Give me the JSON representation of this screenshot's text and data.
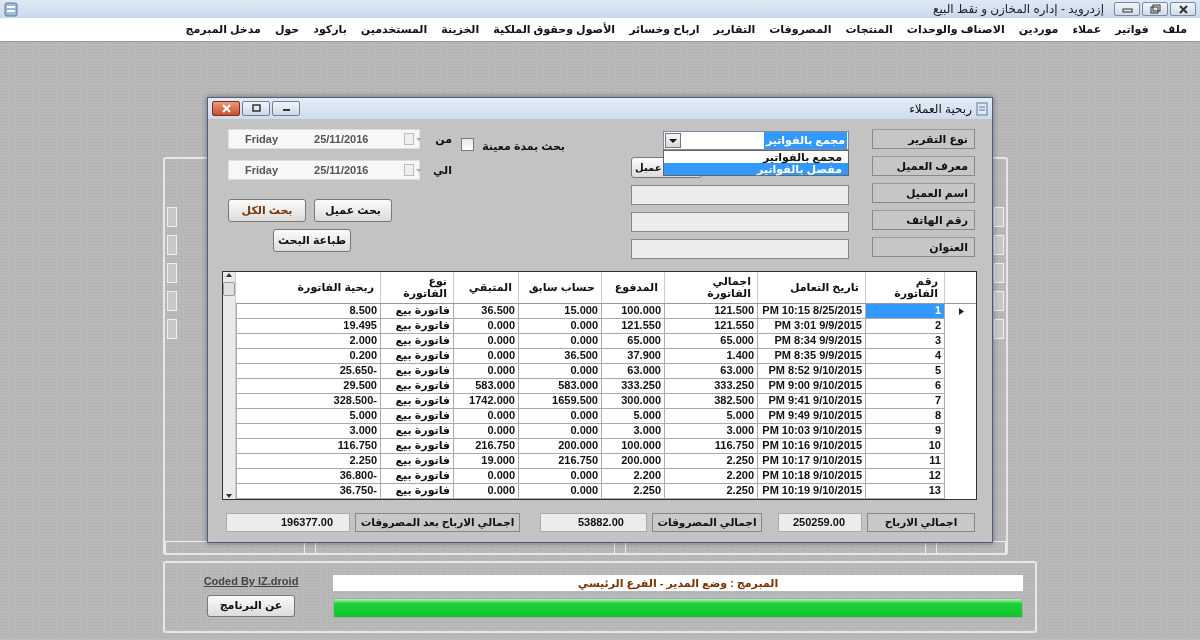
{
  "window": {
    "title": "إزدرويد - إداره المخازن و نقط البيع"
  },
  "menu": [
    "ملف",
    "فواتير",
    "عملاء",
    "موردين",
    "الاصناف والوحدات",
    "المنتجات",
    "المصروفات",
    "التقارير",
    "ارباح وخسائر",
    "الأصول وحقوق الملكية",
    "الخزينة",
    "المستخدمين",
    "باركود",
    "حول",
    "مدخل المبرمج"
  ],
  "dialog": {
    "title": "ربحية العملاء",
    "form_fields": [
      {
        "label": "نوع التقرير",
        "kind": "combo",
        "value": "مجمع بالفواتير"
      },
      {
        "label": "معرف العميل",
        "kind": "button",
        "button": "عميل"
      },
      {
        "label": "اسم العميل",
        "kind": "input"
      },
      {
        "label": "رقم الهاتف",
        "kind": "input"
      },
      {
        "label": "العنوان",
        "kind": "input"
      }
    ],
    "dropdown": [
      {
        "label": "مجمع بالفواتير",
        "selected": false
      },
      {
        "label": "مفصل بالفواتير",
        "selected": true
      }
    ],
    "period_check": {
      "label": "بحث بمدة معينة",
      "checked": false
    },
    "dates": [
      {
        "label": "من",
        "day": "Friday",
        "date": "25/11/2016"
      },
      {
        "label": "الي",
        "day": "Friday",
        "date": "25/11/2016"
      }
    ],
    "buttons": [
      {
        "label": "بحث الكل",
        "focused": true
      },
      {
        "label": "بحث عميل",
        "focused": false
      },
      {
        "label": "طباعة البحث",
        "focused": false
      }
    ],
    "table": {
      "columns": [
        "رقم الفاتورة",
        "تاريخ التعامل",
        "اجمالي الفاتورة",
        "المدفوع",
        "حساب سابق",
        "المتبقي",
        "نوع الفاتورة",
        "ربحية الفاتورة"
      ],
      "rows": [
        {
          "selected": true,
          "cells": [
            "1",
            "8/25/2015 10:15 PM",
            "121.500",
            "100.000",
            "15.000",
            "36.500",
            "فاتورة بيع",
            "8.500"
          ]
        },
        {
          "selected": false,
          "cells": [
            "2",
            "9/9/2015 3:01 PM",
            "121.550",
            "121.550",
            "0.000",
            "0.000",
            "فاتورة بيع",
            "19.495"
          ]
        },
        {
          "selected": false,
          "cells": [
            "3",
            "9/9/2015 8:34 PM",
            "65.000",
            "65.000",
            "0.000",
            "0.000",
            "فاتورة بيع",
            "2.000"
          ]
        },
        {
          "selected": false,
          "cells": [
            "4",
            "9/9/2015 8:35 PM",
            "1.400",
            "37.900",
            "36.500",
            "0.000",
            "فاتورة بيع",
            "0.200"
          ]
        },
        {
          "selected": false,
          "cells": [
            "5",
            "9/10/2015 8:52 PM",
            "63.000",
            "63.000",
            "0.000",
            "0.000",
            "فاتورة بيع",
            "-25.650"
          ]
        },
        {
          "selected": false,
          "cells": [
            "6",
            "9/10/2015 9:00 PM",
            "333.250",
            "333.250",
            "583.000",
            "583.000",
            "فاتورة بيع",
            "29.500"
          ]
        },
        {
          "selected": false,
          "cells": [
            "7",
            "9/10/2015 9:41 PM",
            "382.500",
            "300.000",
            "1659.500",
            "1742.000",
            "فاتورة بيع",
            "-328.500"
          ]
        },
        {
          "selected": false,
          "cells": [
            "8",
            "9/10/2015 9:49 PM",
            "5.000",
            "5.000",
            "0.000",
            "0.000",
            "فاتورة بيع",
            "5.000"
          ]
        },
        {
          "selected": false,
          "cells": [
            "9",
            "9/10/2015 10:03 PM",
            "3.000",
            "3.000",
            "0.000",
            "0.000",
            "فاتورة بيع",
            "3.000"
          ]
        },
        {
          "selected": false,
          "cells": [
            "10",
            "9/10/2015 10:16 PM",
            "116.750",
            "100.000",
            "200.000",
            "216.750",
            "فاتورة بيع",
            "116.750"
          ]
        },
        {
          "selected": false,
          "cells": [
            "11",
            "9/10/2015 10:17 PM",
            "2.250",
            "200.000",
            "216.750",
            "19.000",
            "فاتورة بيع",
            "2.250"
          ]
        },
        {
          "selected": false,
          "cells": [
            "12",
            "9/10/2015 10:18 PM",
            "2.200",
            "2.200",
            "0.000",
            "0.000",
            "فاتورة بيع",
            "-36.800"
          ]
        },
        {
          "selected": false,
          "cells": [
            "13",
            "9/10/2015 10:19 PM",
            "2.250",
            "2.250",
            "0.000",
            "0.000",
            "فاتورة بيع",
            "-36.750"
          ]
        }
      ]
    },
    "totals": [
      {
        "label": "اجمالي الارباح",
        "value": "250259.00"
      },
      {
        "label": "اجمالي المصروفات",
        "value": "53882.00"
      },
      {
        "label": "اجمالي الارباح بعد المصروفات",
        "value": "196377.00"
      }
    ]
  },
  "footer": {
    "credit": "Coded By IZ.droid",
    "about_button": "عن البرنامج",
    "status": "المبرمج : وضع المدير - الفرع الرئيسي",
    "progress": {
      "level": 1
    }
  }
}
